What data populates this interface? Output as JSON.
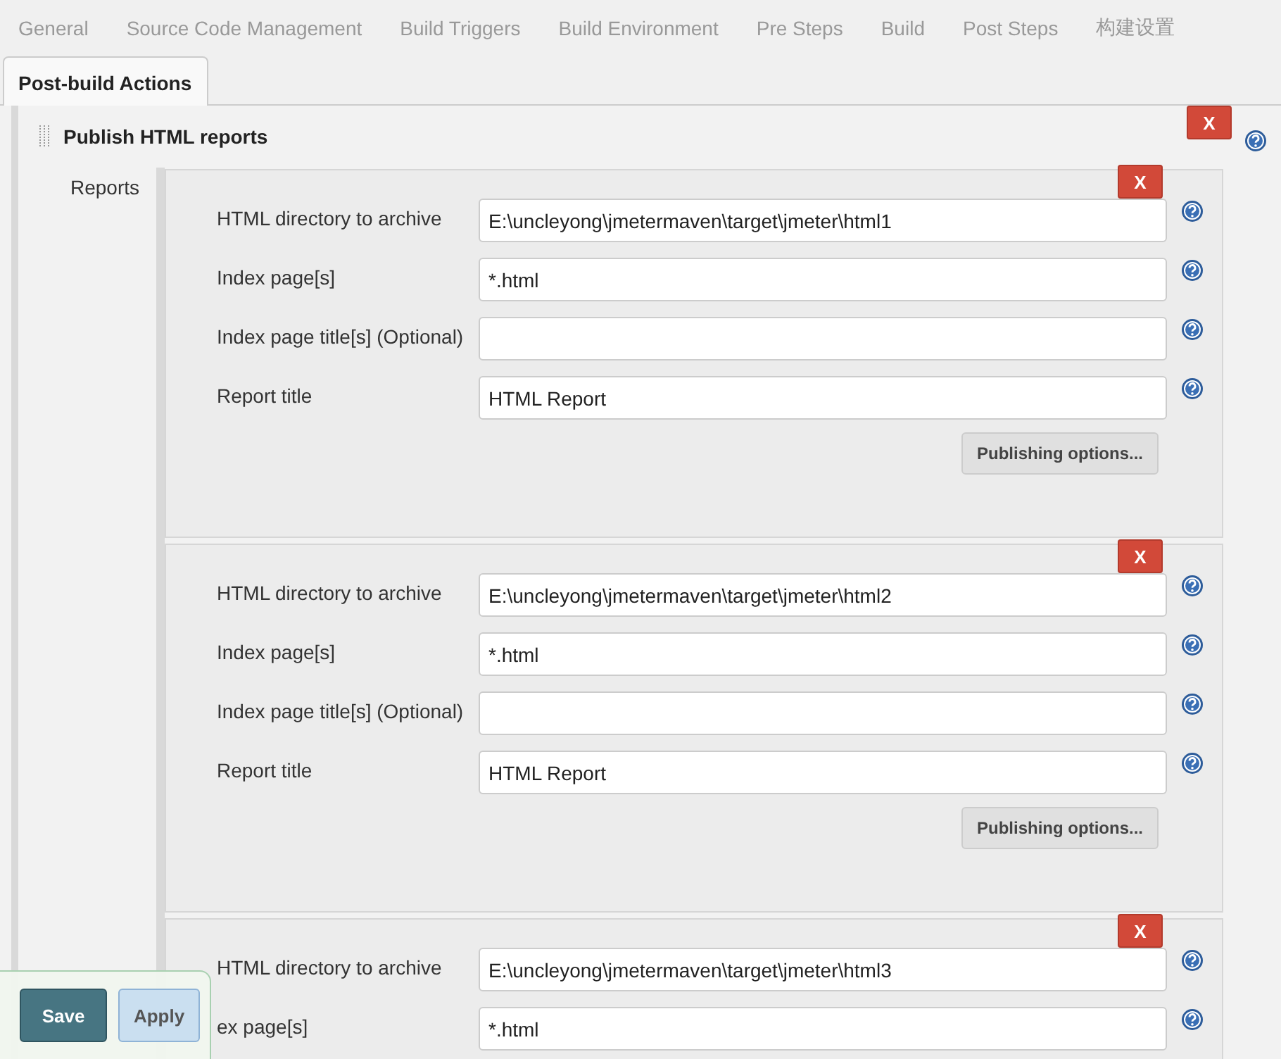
{
  "tabs": [
    {
      "label": "General",
      "selected": false
    },
    {
      "label": "Source Code Management",
      "selected": false
    },
    {
      "label": "Build Triggers",
      "selected": false
    },
    {
      "label": "Build Environment",
      "selected": false
    },
    {
      "label": "Pre Steps",
      "selected": false
    },
    {
      "label": "Build",
      "selected": false
    },
    {
      "label": "Post Steps",
      "selected": false
    },
    {
      "label": "构建设置",
      "selected": false
    },
    {
      "label": "Post-build Actions",
      "selected": true
    }
  ],
  "section": {
    "title": "Publish HTML reports",
    "delete": "X",
    "reports_label": "Reports",
    "reports": [
      {
        "delete": "X",
        "fields": [
          {
            "label": "HTML directory to archive",
            "value": "E:\\uncleyong\\jmetermaven\\target\\jmeter\\html1"
          },
          {
            "label": "Index page[s]",
            "value": "*.html"
          },
          {
            "label": "Index page title[s] (Optional)"
          },
          {
            "label": "Report title",
            "value": "HTML Report"
          }
        ],
        "options_button": "Publishing options..."
      },
      {
        "delete": "X",
        "fields": [
          {
            "label": "HTML directory to archive",
            "value": "E:\\uncleyong\\jmetermaven\\target\\jmeter\\html2"
          },
          {
            "label": "Index page[s]",
            "value": "*.html"
          },
          {
            "label": "Index page title[s] (Optional)"
          },
          {
            "label": "Report title",
            "value": "HTML Report"
          }
        ],
        "options_button": "Publishing options..."
      },
      {
        "delete": "X",
        "fields": [
          {
            "label": "HTML directory to archive",
            "value": "E:\\uncleyong\\jmetermaven\\target\\jmeter\\html3"
          },
          {
            "label": "ex page[s]",
            "value": "*.html"
          }
        ]
      }
    ]
  },
  "bottom_bar": {
    "save": "Save",
    "apply": "Apply"
  }
}
